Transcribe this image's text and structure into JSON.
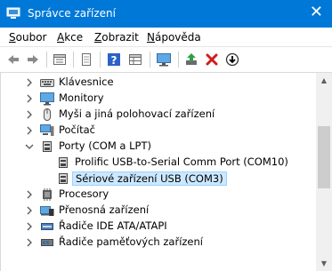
{
  "window": {
    "title": "Správce zařízení",
    "close_glyph": "✕"
  },
  "menu": [
    {
      "pre": "",
      "acc": "S",
      "post": "oubor"
    },
    {
      "pre": "",
      "acc": "A",
      "post": "kce"
    },
    {
      "pre": "",
      "acc": "Z",
      "post": "obrazit"
    },
    {
      "pre": "",
      "acc": "N",
      "post": "ápověda"
    }
  ],
  "toolbar": {
    "icons": [
      "back-arrow-icon",
      "forward-arrow-icon",
      "properties-grid-icon",
      "document-icon",
      "help-question-icon",
      "details-grid-icon",
      "monitor-scan-icon",
      "update-driver-icon",
      "uninstall-x-icon",
      "disable-down-icon"
    ]
  },
  "tree": {
    "items": [
      {
        "label": "Klávesnice",
        "expanded": false,
        "icon": "keyboard-icon",
        "level": 1
      },
      {
        "label": "Monitory",
        "expanded": false,
        "icon": "monitor-icon",
        "level": 1
      },
      {
        "label": "Myši a jiná polohovací zařízení",
        "expanded": false,
        "icon": "mouse-icon",
        "level": 1
      },
      {
        "label": "Počítač",
        "expanded": false,
        "icon": "computer-icon",
        "level": 1
      },
      {
        "label": "Porty (COM a LPT)",
        "expanded": true,
        "icon": "port-icon",
        "level": 1
      },
      {
        "label": "Prolific USB-to-Serial Comm Port (COM10)",
        "icon": "port-icon",
        "level": 2
      },
      {
        "label": "Sériové zařízení USB (COM3)",
        "icon": "port-icon",
        "level": 2,
        "selected": true
      },
      {
        "label": "Procesory",
        "expanded": false,
        "icon": "processor-icon",
        "level": 1
      },
      {
        "label": "Přenosná zařízení",
        "expanded": false,
        "icon": "portable-device-icon",
        "level": 1
      },
      {
        "label": "Řadiče IDE ATA/ATAPI",
        "expanded": false,
        "icon": "ide-controller-icon",
        "level": 1
      },
      {
        "label": "Řadiče paměťových zařízení",
        "expanded": false,
        "icon": "storage-controller-icon",
        "level": 1
      }
    ]
  },
  "colors": {
    "titlebar": "#0078d7",
    "selection_bg": "#cce8ff",
    "selection_border": "#99d1ff"
  }
}
